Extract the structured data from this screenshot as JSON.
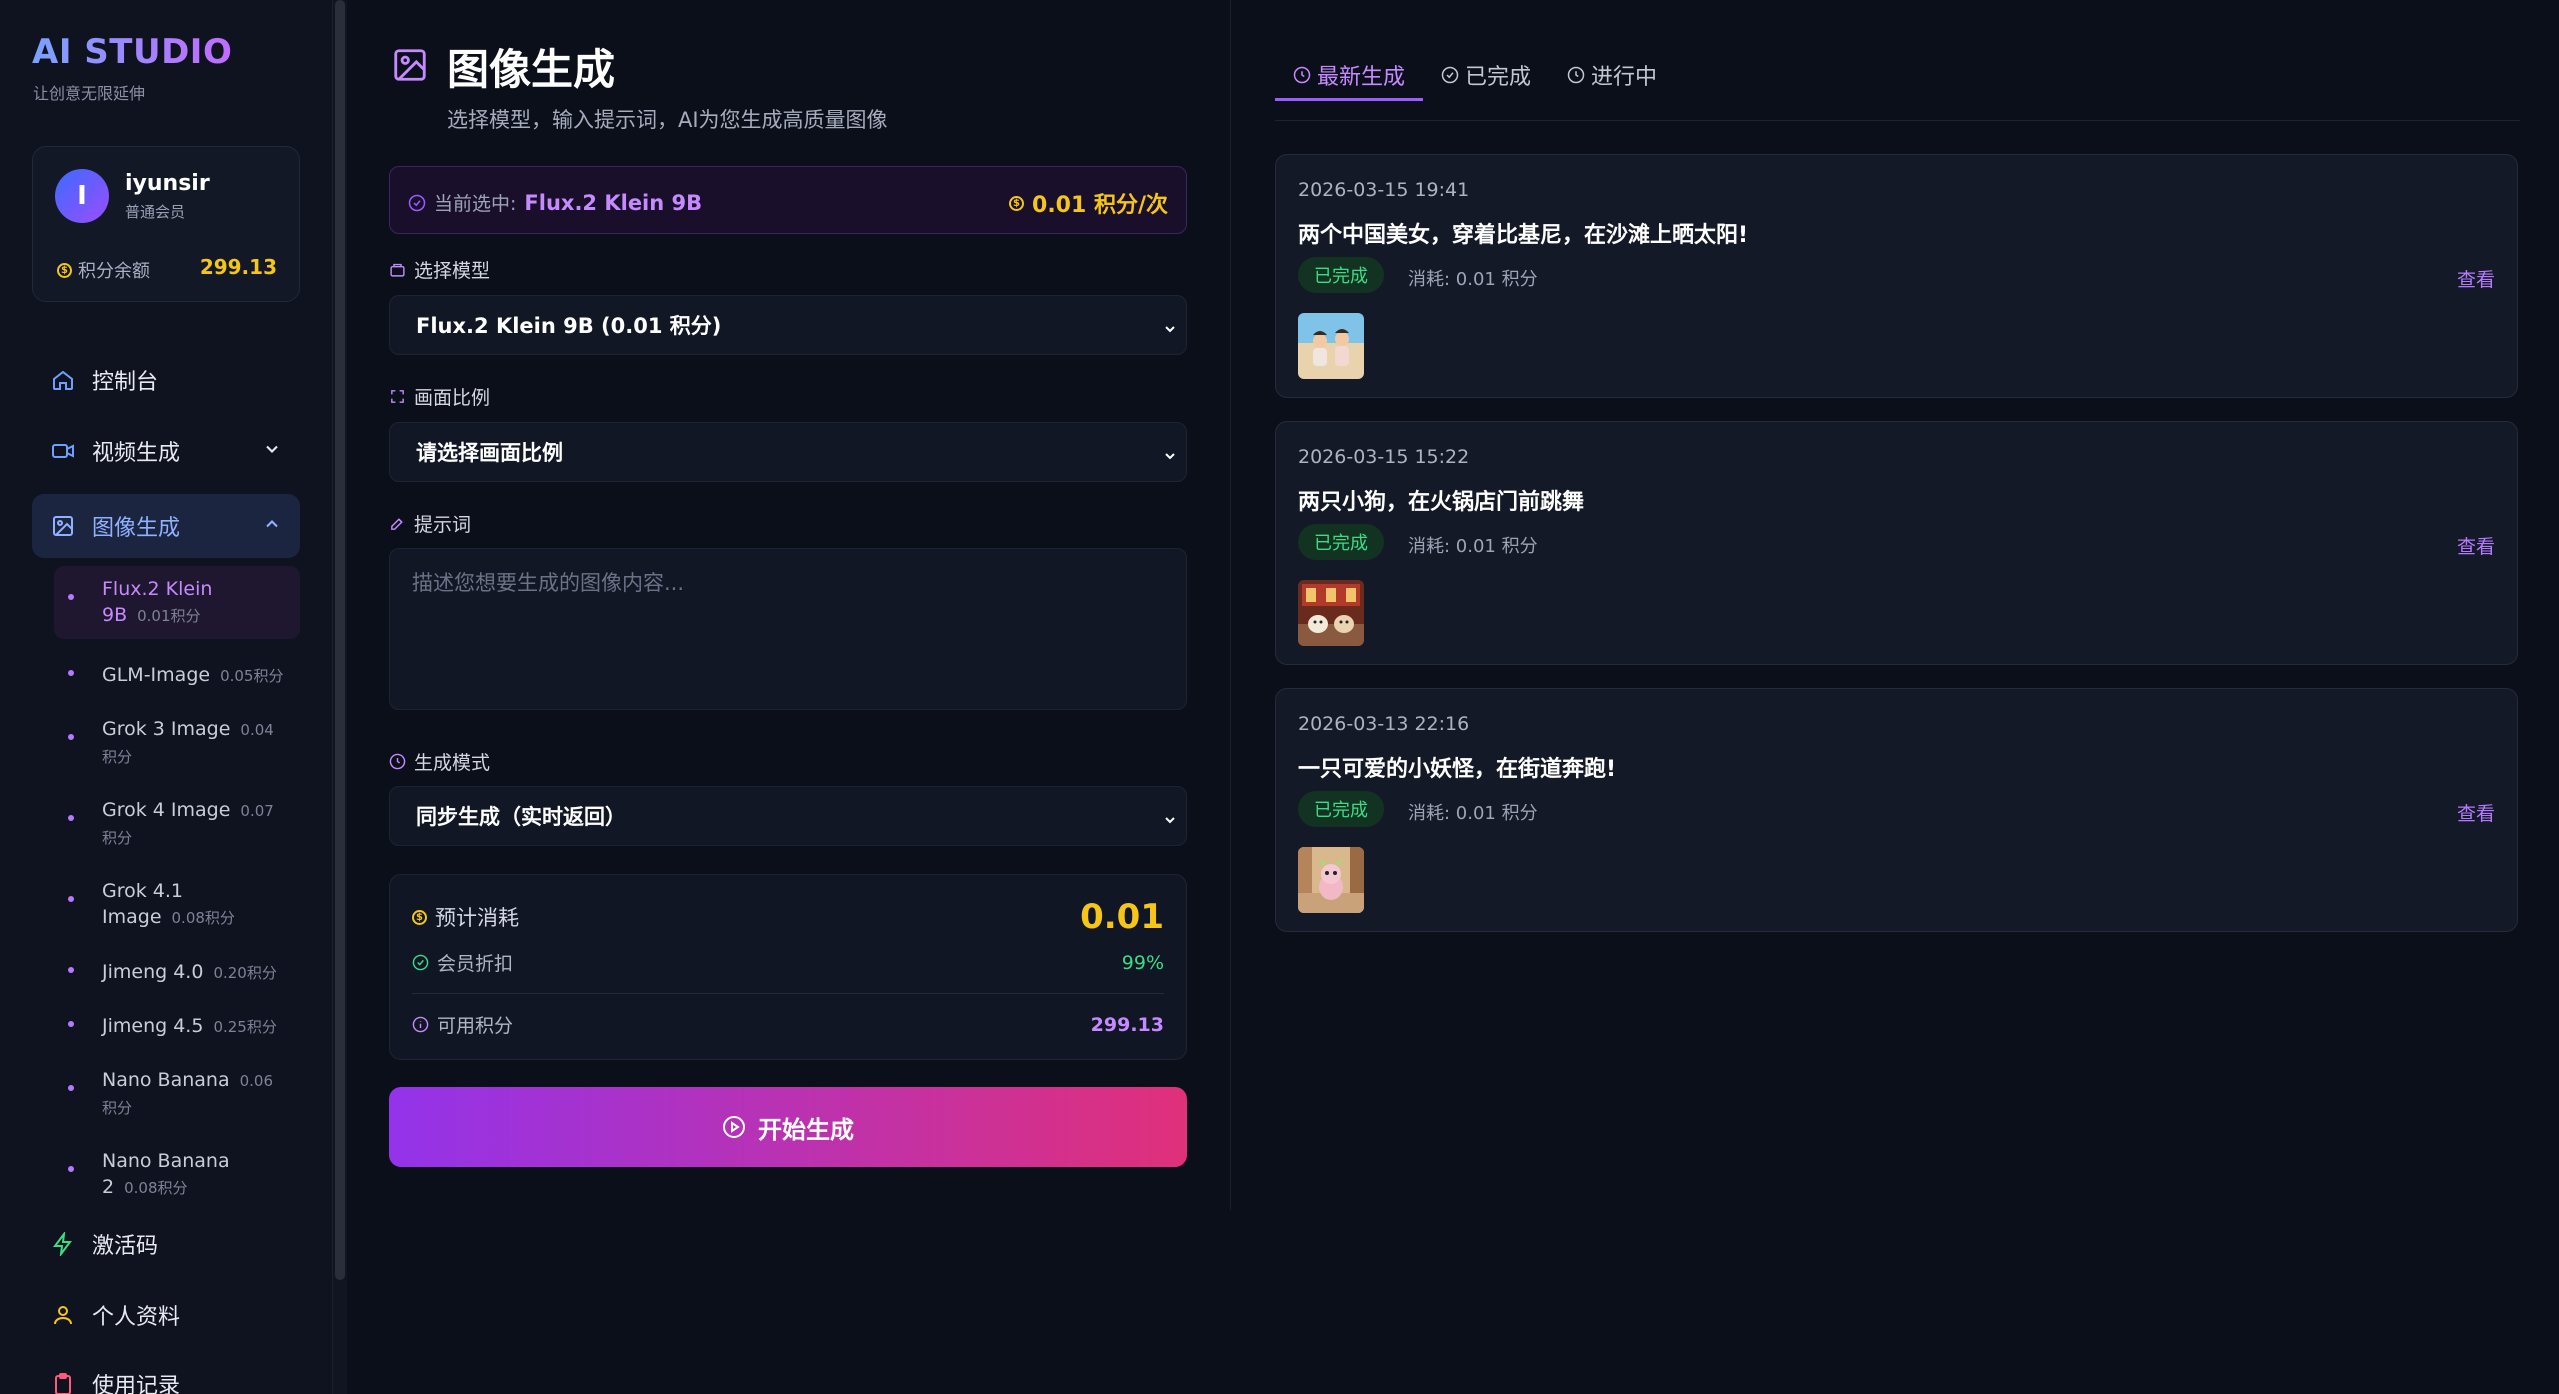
{
  "brand": {
    "name": "AI STUDIO",
    "tagline": "让创意无限延伸"
  },
  "user": {
    "initial": "I",
    "name": "iyunsir",
    "role": "普通会员",
    "balance_label": "积分余额",
    "balance": "299.13"
  },
  "nav": {
    "dashboard": "控制台",
    "video": "视频生成",
    "image": "图像生成",
    "activation": "激活码",
    "profile": "个人资料",
    "usage": "使用记录"
  },
  "models": [
    {
      "name": "Flux.2 Klein 9B",
      "cost": "0.01积分"
    },
    {
      "name": "GLM-Image",
      "cost": "0.05积分"
    },
    {
      "name": "Grok 3 Image",
      "cost": "0.04积分"
    },
    {
      "name": "Grok 4 Image",
      "cost": "0.07积分"
    },
    {
      "name": "Grok 4.1 Image",
      "cost": "0.08积分"
    },
    {
      "name": "Jimeng 4.0",
      "cost": "0.20积分"
    },
    {
      "name": "Jimeng 4.5",
      "cost": "0.25积分"
    },
    {
      "name": "Nano Banana",
      "cost": "0.06积分"
    },
    {
      "name": "Nano Banana 2",
      "cost": "0.08积分"
    }
  ],
  "page": {
    "title": "图像生成",
    "subtitle": "选择模型，输入提示词，AI为您生成高质量图像",
    "current_label": "当前选中:",
    "current_model": "Flux.2 Klein 9B",
    "current_price": "0.01 积分/次",
    "model_label": "选择模型",
    "model_value": "Flux.2 Klein 9B (0.01 积分)",
    "ratio_label": "画面比例",
    "ratio_value": "请选择画面比例",
    "prompt_label": "提示词",
    "prompt_placeholder": "描述您想要生成的图像内容...",
    "mode_label": "生成模式",
    "mode_value": "同步生成（实时返回）",
    "est_cost_label": "预计消耗",
    "est_cost_value": "0.01",
    "discount_label": "会员折扣",
    "discount_value": "99%",
    "available_label": "可用积分",
    "available_value": "299.13",
    "generate_button": "开始生成"
  },
  "tabs": [
    "最新生成",
    "已完成",
    "进行中"
  ],
  "history": [
    {
      "date": "2026-03-15 19:41",
      "title": "两个中国美女，穿着比基尼，在沙滩上晒太阳!",
      "status": "已完成",
      "spent": "消耗: 0.01 积分",
      "view": "查看"
    },
    {
      "date": "2026-03-15 15:22",
      "title": "两只小狗，在火锅店门前跳舞",
      "status": "已完成",
      "spent": "消耗: 0.01 积分",
      "view": "查看"
    },
    {
      "date": "2026-03-13 22:16",
      "title": "一只可爱的小妖怪，在街道奔跑!",
      "status": "已完成",
      "spent": "消耗: 0.01 积分",
      "view": "查看"
    }
  ],
  "colors": {
    "accent": "#c68aff",
    "gold": "#f5c518",
    "success": "#3ddc84",
    "link": "#b57aff"
  }
}
